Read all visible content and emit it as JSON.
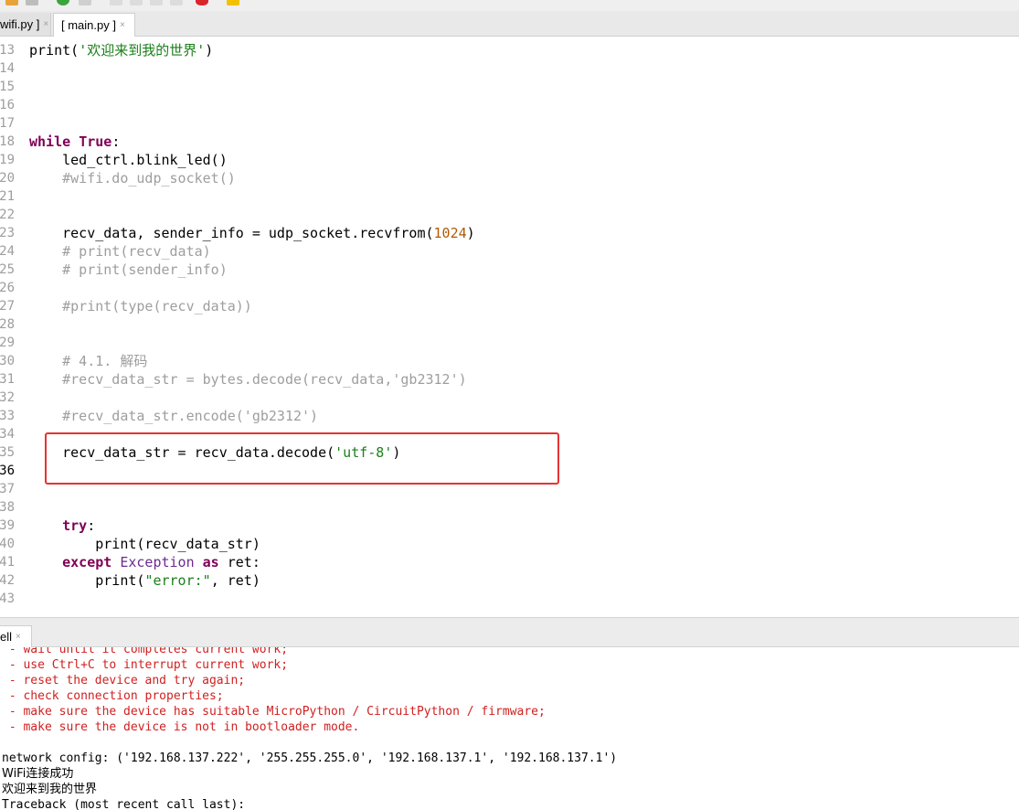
{
  "tabs": [
    {
      "label": "wifi.py ]",
      "close": "×"
    },
    {
      "label": "[ main.py ]",
      "close": "×"
    }
  ],
  "editor": {
    "lines": [
      {
        "n": "13",
        "segs": [
          {
            "t": "print(",
            "c": ""
          },
          {
            "t": "'欢迎来到我的世界'",
            "c": "str"
          },
          {
            "t": ")",
            "c": ""
          }
        ]
      },
      {
        "n": "14",
        "segs": []
      },
      {
        "n": "15",
        "segs": []
      },
      {
        "n": "16",
        "segs": []
      },
      {
        "n": "17",
        "segs": []
      },
      {
        "n": "18",
        "segs": [
          {
            "t": "while",
            "c": "kw"
          },
          {
            "t": " ",
            "c": ""
          },
          {
            "t": "True",
            "c": "kw"
          },
          {
            "t": ":",
            "c": ""
          }
        ]
      },
      {
        "n": "19",
        "segs": [
          {
            "t": "    led_ctrl.blink_led()",
            "c": ""
          }
        ]
      },
      {
        "n": "20",
        "segs": [
          {
            "t": "    #wifi.do_udp_socket()",
            "c": "cmt"
          }
        ]
      },
      {
        "n": "21",
        "segs": []
      },
      {
        "n": "22",
        "segs": []
      },
      {
        "n": "23",
        "segs": [
          {
            "t": "    recv_data, sender_info = udp_socket.recvfrom(",
            "c": ""
          },
          {
            "t": "1024",
            "c": "num"
          },
          {
            "t": ")",
            "c": ""
          }
        ]
      },
      {
        "n": "24",
        "segs": [
          {
            "t": "    # print(recv_data)",
            "c": "cmt"
          }
        ]
      },
      {
        "n": "25",
        "segs": [
          {
            "t": "    # print(sender_info)",
            "c": "cmt"
          }
        ]
      },
      {
        "n": "26",
        "segs": []
      },
      {
        "n": "27",
        "segs": [
          {
            "t": "    #print(type(recv_data))",
            "c": "cmt"
          }
        ]
      },
      {
        "n": "28",
        "segs": []
      },
      {
        "n": "29",
        "segs": []
      },
      {
        "n": "30",
        "segs": [
          {
            "t": "    # 4.1. 解码",
            "c": "cmt"
          }
        ]
      },
      {
        "n": "31",
        "segs": [
          {
            "t": "    #recv_data_str = bytes.decode(recv_data,'gb2312')",
            "c": "cmt"
          }
        ]
      },
      {
        "n": "32",
        "segs": []
      },
      {
        "n": "33",
        "segs": [
          {
            "t": "    #recv_data_str.encode('gb2312')",
            "c": "cmt"
          }
        ]
      },
      {
        "n": "34",
        "segs": []
      },
      {
        "n": "35",
        "segs": [
          {
            "t": "    recv_data_str = recv_data.decode(",
            "c": ""
          },
          {
            "t": "'utf-8'",
            "c": "str"
          },
          {
            "t": ")",
            "c": ""
          }
        ]
      },
      {
        "n": "36",
        "segs": [],
        "current": true
      },
      {
        "n": "37",
        "segs": []
      },
      {
        "n": "38",
        "segs": []
      },
      {
        "n": "39",
        "segs": [
          {
            "t": "    ",
            "c": ""
          },
          {
            "t": "try",
            "c": "kw"
          },
          {
            "t": ":",
            "c": ""
          }
        ]
      },
      {
        "n": "40",
        "segs": [
          {
            "t": "        print(recv_data_str)",
            "c": ""
          }
        ]
      },
      {
        "n": "41",
        "segs": [
          {
            "t": "    ",
            "c": ""
          },
          {
            "t": "except",
            "c": "kw"
          },
          {
            "t": " ",
            "c": ""
          },
          {
            "t": "Exception",
            "c": "exc"
          },
          {
            "t": " ",
            "c": ""
          },
          {
            "t": "as",
            "c": "kw"
          },
          {
            "t": " ret:",
            "c": ""
          }
        ]
      },
      {
        "n": "42",
        "segs": [
          {
            "t": "        print(",
            "c": ""
          },
          {
            "t": "\"error:\"",
            "c": "str"
          },
          {
            "t": ", ret)",
            "c": ""
          }
        ]
      },
      {
        "n": "43",
        "segs": []
      }
    ]
  },
  "shell": {
    "tab_label": "ell",
    "tab_close": "×",
    "lines": [
      {
        "t": " - wait until it completes current work;",
        "c": "err"
      },
      {
        "t": " - use Ctrl+C to interrupt current work;",
        "c": "err"
      },
      {
        "t": " - reset the device and try again;",
        "c": "err"
      },
      {
        "t": " - check connection properties;",
        "c": "err"
      },
      {
        "t": " - make sure the device has suitable MicroPython / CircuitPython / firmware;",
        "c": "err"
      },
      {
        "t": " - make sure the device is not in bootloader mode.",
        "c": "err"
      },
      {
        "t": "",
        "c": ""
      },
      {
        "t": "network config: ('192.168.137.222', '255.255.255.0', '192.168.137.1', '192.168.137.1')",
        "c": ""
      },
      {
        "t": "WiFi连接成功",
        "c": "cjk"
      },
      {
        "t": "欢迎来到我的世界",
        "c": "cjk"
      },
      {
        "t": "Traceback (most recent call last):",
        "c": ""
      }
    ]
  },
  "colors": {
    "keyword": "#7f0055",
    "string": "#1a7f1a",
    "number": "#b05a00",
    "comment": "#9e9e9e",
    "error_text": "#d12020",
    "highlight_box": "#e53333"
  }
}
